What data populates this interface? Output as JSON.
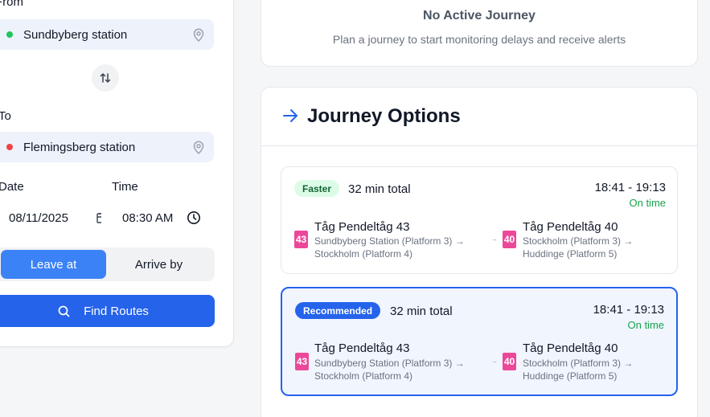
{
  "form": {
    "from_label": "From",
    "from_value": "Sundbyberg station",
    "to_label": "To",
    "to_value": "Flemingsberg station",
    "date_label": "Date",
    "date_value": "08/11/2025",
    "time_label": "Time",
    "time_value": "08:30 AM",
    "leave_at_label": "Leave at",
    "arrive_by_label": "Arrive by",
    "find_routes_label": "Find Routes"
  },
  "status": {
    "title": "No Active Journey",
    "subtitle": "Plan a journey to start monitoring delays and receive alerts"
  },
  "options": {
    "title": "Journey Options",
    "items": [
      {
        "badge": "Faster",
        "total": "32 min total",
        "times": "18:41 - 19:13",
        "status": "On time",
        "legs": [
          {
            "line": "43",
            "name": "Tåg Pendeltåg 43",
            "route_line1": "Sundbyberg Station (Platform 3) →",
            "route_line2": "Stockholm (Platform 4)"
          },
          {
            "line": "40",
            "name": "Tåg Pendeltåg 40",
            "route_line1": "Stockholm (Platform 3) →",
            "route_line2": "Huddinge (Platform 5)"
          }
        ],
        "connector": "→"
      },
      {
        "badge": "Recommended",
        "total": "32 min total",
        "times": "18:41 - 19:13",
        "status": "On time",
        "legs": [
          {
            "line": "43",
            "name": "Tåg Pendeltåg 43",
            "route_line1": "Sundbyberg Station (Platform 3) →",
            "route_line2": "Stockholm (Platform 4)"
          },
          {
            "line": "40",
            "name": "Tåg Pendeltåg 40",
            "route_line1": "Stockholm (Platform 3) →",
            "route_line2": "Huddinge (Platform 5)"
          }
        ],
        "connector": "→"
      }
    ]
  },
  "colors": {
    "accent": "#2563eb",
    "from_dot": "#22c55e",
    "to_dot": "#ef4444",
    "line_badge": "#ec4899",
    "on_time": "#16a34a"
  },
  "icons": {
    "from_pin": "map-pin-icon",
    "to_pin": "map-pin-icon",
    "swap": "swap-vertical-icon",
    "calendar": "calendar-icon",
    "clock": "clock-icon",
    "search": "search-icon",
    "options_arrow": "arrow-right-icon"
  }
}
